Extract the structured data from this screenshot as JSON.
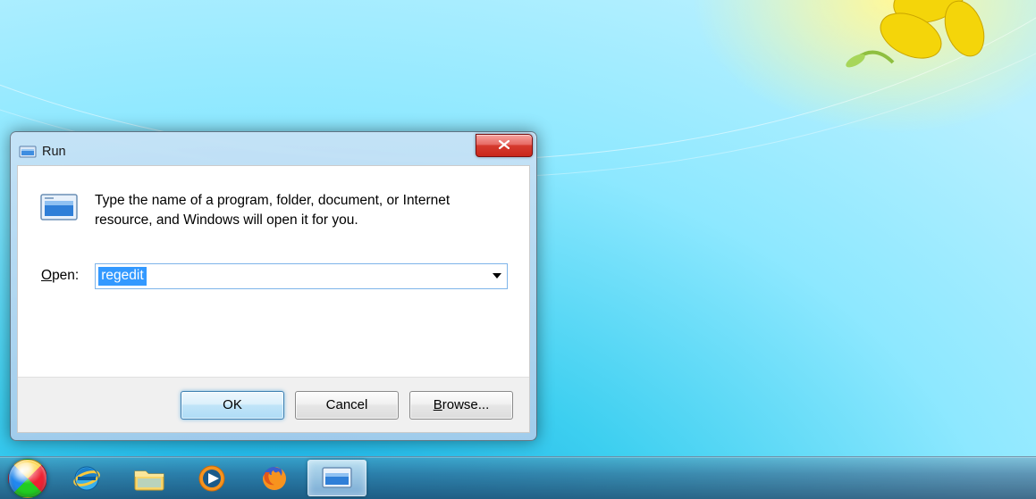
{
  "dialog": {
    "title": "Run",
    "description": "Type the name of a program, folder, document, or Internet resource, and Windows will open it for you.",
    "open_label_prefix": "O",
    "open_label_rest": "pen:",
    "input_value": "regedit",
    "buttons": {
      "ok": "OK",
      "cancel": "Cancel",
      "browse_prefix": "B",
      "browse_rest": "rowse..."
    }
  },
  "taskbar": {
    "items": [
      {
        "name": "start",
        "label": "Start"
      },
      {
        "name": "internet-explorer",
        "label": "Internet Explorer"
      },
      {
        "name": "file-explorer",
        "label": "File Explorer"
      },
      {
        "name": "media-player",
        "label": "Windows Media Player"
      },
      {
        "name": "firefox",
        "label": "Firefox"
      },
      {
        "name": "run-dialog",
        "label": "Run",
        "active": true
      }
    ]
  }
}
